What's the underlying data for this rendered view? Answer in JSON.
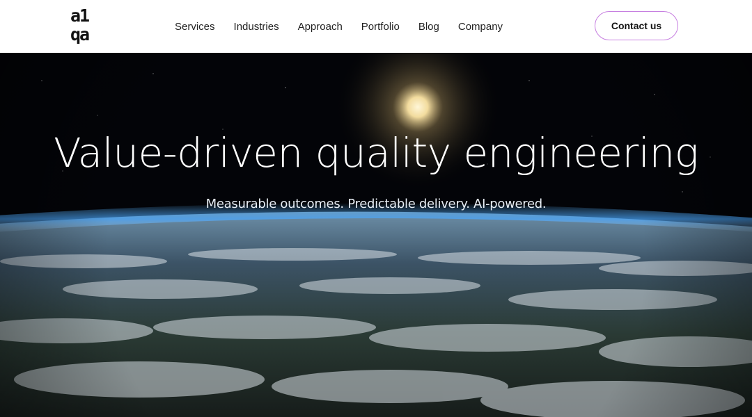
{
  "brand": {
    "logo_line1": "a1",
    "logo_line2": "qa"
  },
  "nav": {
    "items": [
      {
        "label": "Services"
      },
      {
        "label": "Industries"
      },
      {
        "label": "Approach"
      },
      {
        "label": "Portfolio"
      },
      {
        "label": "Blog"
      },
      {
        "label": "Company"
      }
    ]
  },
  "header": {
    "contact_label": "Contact us"
  },
  "hero": {
    "title": "Value-driven quality engineering",
    "subtitle": "Measurable outcomes. Predictable delivery. AI-powered.",
    "background": "earth-from-space-image"
  },
  "colors": {
    "header_bg": "#ffffff",
    "contact_border": "#c67ee0",
    "hero_text": "#ffffff"
  }
}
